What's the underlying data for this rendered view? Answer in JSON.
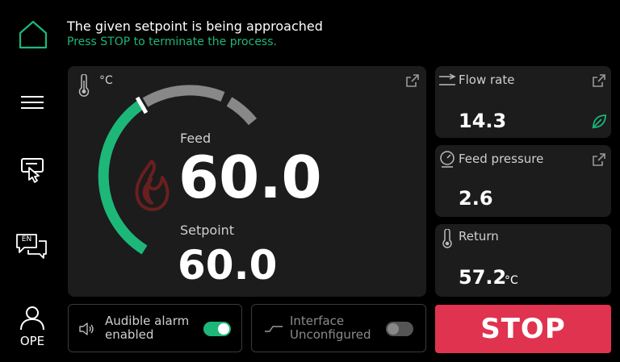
{
  "header": {
    "status_title": "The given setpoint is being approached",
    "status_sub": "Press STOP to terminate the process."
  },
  "sidebar": {
    "language": "EN",
    "user": "OPE"
  },
  "gauge": {
    "unit": "°C",
    "feed_label": "Feed",
    "feed_value": "60.0",
    "setpoint_label": "Setpoint",
    "setpoint_value": "60.0"
  },
  "flow": {
    "label": "Flow rate",
    "value": "14.3"
  },
  "pressure": {
    "label": "Feed pressure",
    "value": "2.6"
  },
  "return_temp": {
    "label": "Return",
    "value": "57.2",
    "unit": "°C"
  },
  "alarm": {
    "line1": "Audible alarm",
    "line2": "enabled",
    "enabled": true
  },
  "interface": {
    "line1": "Interface",
    "line2": "Unconfigured",
    "enabled": false
  },
  "stop": {
    "label": "STOP"
  },
  "colors": {
    "accent": "#1db77a",
    "stop": "#e0334f",
    "status_sub": "#1db77a",
    "flame": "#6a1f1f"
  }
}
